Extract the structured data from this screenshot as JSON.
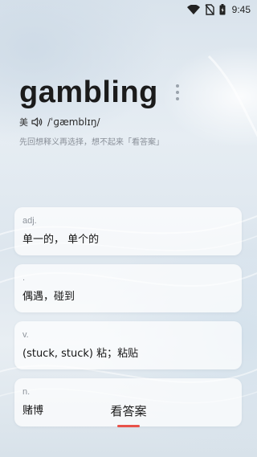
{
  "status_bar": {
    "time": "9:45",
    "icons": [
      "wifi-icon",
      "no-sim-icon",
      "battery-icon"
    ]
  },
  "word": {
    "text": "gambling",
    "region": "美",
    "phonetic": "/ˈɡæmblɪŋ/",
    "hint": "先回想释义再选择，想不起来「看答案」"
  },
  "definitions": [
    {
      "pos": "adj.",
      "meaning": "单一的， 单个的"
    },
    {
      "pos": ".",
      "meaning": "偶遇，碰到"
    },
    {
      "pos": "v.",
      "meaning": "(stuck, stuck) 粘；粘贴"
    },
    {
      "pos": "n.",
      "meaning": "赌博"
    }
  ],
  "answer_button": {
    "label": "看答案",
    "accent_color": "#e8524a"
  }
}
